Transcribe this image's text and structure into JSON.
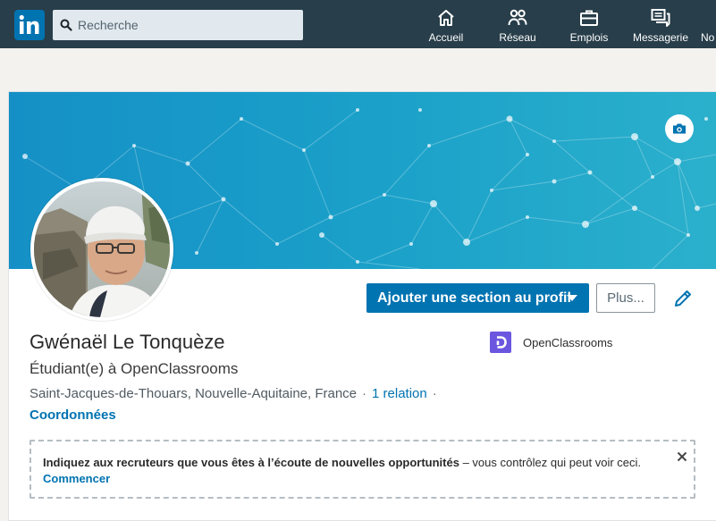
{
  "nav": {
    "search_placeholder": "Recherche",
    "items": [
      {
        "label": "Accueil",
        "icon": "home-icon"
      },
      {
        "label": "Réseau",
        "icon": "network-icon"
      },
      {
        "label": "Emplois",
        "icon": "briefcase-icon"
      },
      {
        "label": "Messagerie",
        "icon": "messaging-icon"
      },
      {
        "label": "No",
        "icon": "notifications-icon"
      }
    ]
  },
  "profile": {
    "name": "Gwénaël Le Tonquèze",
    "headline": "Étudiant(e) à OpenClassrooms",
    "location": "Saint-Jacques-de-Thouars, Nouvelle-Aquitaine, France",
    "separator": "·",
    "relations": "1 relation",
    "contact_label": "Coordonnées",
    "company": "OpenClassrooms"
  },
  "actions": {
    "add_section_label": "Ajouter une section au profil",
    "more_label": "Plus..."
  },
  "opportunities": {
    "bold_text": "Indiquez aux recruteurs que vous êtes à l’écoute de nouvelles opportunités",
    "rest_text": " – vous contrôlez qui peut voir ceci.",
    "start_label": "Commencer"
  },
  "colors": {
    "nav_bg": "#283e4a",
    "brand_blue": "#0073b1",
    "banner": "#1e9fc4",
    "company_logo": "#6b56e0"
  }
}
